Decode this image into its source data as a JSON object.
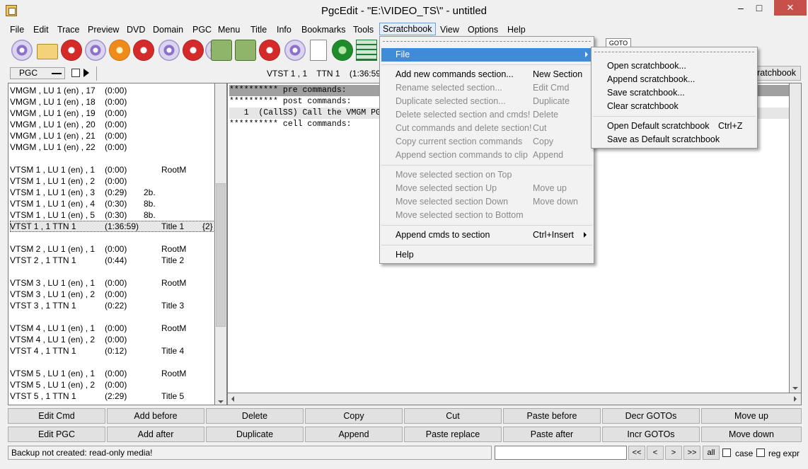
{
  "window": {
    "title": "PgcEdit -   \"E:\\VIDEO_TS\\\" - untitled",
    "min_glyph": "–",
    "max_glyph": "□",
    "close_glyph": "✕"
  },
  "menubar": [
    "File",
    "Edit",
    "Trace",
    "Preview",
    "DVD",
    "Domain",
    "PGC",
    "Menu",
    "Title",
    "Info",
    "Bookmarks",
    "Tools",
    "Scratchbook",
    "View",
    "Options",
    "Help"
  ],
  "toolbar": {
    "icons": [
      "open-disc-icon",
      "open-folder-icon",
      "reload-icon",
      "new-disc-icon",
      "burn-icon",
      "search-disc-icon",
      "compare-discs-icon",
      "remove-disc-icon",
      "preview-disc-icon",
      "money-icon",
      "money-check-icon",
      "check-disc-icon",
      "disc-tool-icon",
      "document-icon",
      "globe-icon",
      "play-grid-icon"
    ],
    "goto_label": "GOTO"
  },
  "pgc_bar": {
    "selector": "PGC",
    "info": "VTST 1 , 1    TTN 1    (1:36:59)    Ti",
    "scratchbook_button": "Scratchbook"
  },
  "pgc_list": [
    {
      "a": "VMGM , LU 1 (en) , 17",
      "b": "(0:00)",
      "c": "",
      "d": ""
    },
    {
      "a": "VMGM , LU 1 (en) , 18",
      "b": "(0:00)",
      "c": "",
      "d": ""
    },
    {
      "a": "VMGM , LU 1 (en) , 19",
      "b": "(0:00)",
      "c": "",
      "d": ""
    },
    {
      "a": "VMGM , LU 1 (en) , 20",
      "b": "(0:00)",
      "c": "",
      "d": ""
    },
    {
      "a": "VMGM , LU 1 (en) , 21",
      "b": "(0:00)",
      "c": "",
      "d": ""
    },
    {
      "a": "VMGM , LU 1 (en) , 22",
      "b": "(0:00)",
      "c": "",
      "d": ""
    },
    {
      "a": "",
      "b": "",
      "c": "",
      "d": ""
    },
    {
      "a": "VTSM 1 , LU 1 (en) , 1",
      "b": "(0:00)",
      "c": "",
      "d": "RootM"
    },
    {
      "a": "VTSM 1 , LU 1 (en) , 2",
      "b": "(0:00)",
      "c": "",
      "d": ""
    },
    {
      "a": "VTSM 1 , LU 1 (en) , 3",
      "b": "(0:29)",
      "c": "2b.",
      "d": ""
    },
    {
      "a": "VTSM 1 , LU 1 (en) , 4",
      "b": "(0:30)",
      "c": "8b.",
      "d": ""
    },
    {
      "a": "VTSM 1 , LU 1 (en) , 5",
      "b": "(0:30)",
      "c": "8b.",
      "d": ""
    },
    {
      "a": "VTST 1 , 1      TTN 1",
      "b": "(1:36:59)",
      "c": "",
      "d": "Title 1",
      "e": "{2}",
      "selected": true
    },
    {
      "a": "",
      "b": "",
      "c": "",
      "d": ""
    },
    {
      "a": "VTSM 2 , LU 1 (en) , 1",
      "b": "(0:00)",
      "c": "",
      "d": "RootM"
    },
    {
      "a": "VTST 2 , 1      TTN 1",
      "b": "(0:44)",
      "c": "",
      "d": "Title 2"
    },
    {
      "a": "",
      "b": "",
      "c": "",
      "d": ""
    },
    {
      "a": "VTSM 3 , LU 1 (en) , 1",
      "b": "(0:00)",
      "c": "",
      "d": "RootM"
    },
    {
      "a": "VTSM 3 , LU 1 (en) , 2",
      "b": "(0:00)",
      "c": "",
      "d": ""
    },
    {
      "a": "VTST 3 , 1      TTN 1",
      "b": "(0:22)",
      "c": "",
      "d": "Title 3"
    },
    {
      "a": "",
      "b": "",
      "c": "",
      "d": ""
    },
    {
      "a": "VTSM 4 , LU 1 (en) , 1",
      "b": "(0:00)",
      "c": "",
      "d": "RootM"
    },
    {
      "a": "VTSM 4 , LU 1 (en) , 2",
      "b": "(0:00)",
      "c": "",
      "d": ""
    },
    {
      "a": "VTST 4 , 1      TTN 1",
      "b": "(0:12)",
      "c": "",
      "d": "Title 4"
    },
    {
      "a": "",
      "b": "",
      "c": "",
      "d": ""
    },
    {
      "a": "VTSM 5 , LU 1 (en) , 1",
      "b": "(0:00)",
      "c": "",
      "d": "RootM"
    },
    {
      "a": "VTSM 5 , LU 1 (en) , 2",
      "b": "(0:00)",
      "c": "",
      "d": ""
    },
    {
      "a": "VTST 5 , 1      TTN 1",
      "b": "(2:29)",
      "c": "",
      "d": "Title 5"
    }
  ],
  "code_lines": [
    {
      "text": "********** pre commands:",
      "style": "hl"
    },
    {
      "text": "********** post commands:",
      "style": ""
    },
    {
      "text": "   1  (CallSS) Call the VMGM PGC",
      "style": "hl2"
    },
    {
      "text": "********** cell commands:",
      "style": ""
    }
  ],
  "action_buttons_row1": [
    "Edit Cmd",
    "Add before",
    "Delete",
    "Copy",
    "Cut",
    "Paste before",
    "Decr GOTOs",
    "Move up"
  ],
  "action_buttons_row2": [
    "Edit PGC",
    "Add after",
    "Duplicate",
    "Append",
    "Paste replace",
    "Paste after",
    "Incr GOTOs",
    "Move down"
  ],
  "statusbar": {
    "message": "Backup not created: read-only media!",
    "search_value": "",
    "nav": [
      "<<",
      "<",
      ">",
      ">>",
      "all"
    ],
    "case_label": "case",
    "regexpr_label": "reg expr"
  },
  "scratchbook_menu": [
    {
      "label": "File",
      "acc": "",
      "state": "hot",
      "submenu": true
    },
    {
      "sep": true
    },
    {
      "label": "Add new commands section...",
      "acc": "New Section",
      "state": ""
    },
    {
      "label": "Rename selected section...",
      "acc": "Edit Cmd",
      "state": "dis"
    },
    {
      "label": "Duplicate selected section...",
      "acc": "Duplicate",
      "state": "dis"
    },
    {
      "label": "Delete selected section and cmds!",
      "acc": "Delete",
      "state": "dis"
    },
    {
      "label": "Cut commands and delete section!",
      "acc": "Cut",
      "state": "dis"
    },
    {
      "label": "Copy current section commands",
      "acc": "Copy",
      "state": "dis"
    },
    {
      "label": "Append section commands to clip",
      "acc": "Append",
      "state": "dis"
    },
    {
      "sep": true
    },
    {
      "label": "Move selected section on Top",
      "acc": "",
      "state": "dis"
    },
    {
      "label": "Move selected section Up",
      "acc": "Move up",
      "state": "dis"
    },
    {
      "label": "Move selected section Down",
      "acc": "Move down",
      "state": "dis"
    },
    {
      "label": "Move selected section to Bottom",
      "acc": "",
      "state": "dis"
    },
    {
      "sep": true
    },
    {
      "label": "Append cmds to section",
      "acc": "Ctrl+Insert",
      "state": "",
      "submenu": true
    },
    {
      "sep": true
    },
    {
      "label": "Help",
      "acc": "",
      "state": ""
    }
  ],
  "file_submenu": [
    {
      "label": "Open scratchbook...",
      "acc": ""
    },
    {
      "label": "Append scratchbook...",
      "acc": ""
    },
    {
      "label": "Save scratchbook...",
      "acc": ""
    },
    {
      "label": "Clear scratchbook",
      "acc": ""
    },
    {
      "sep": true
    },
    {
      "label": "Open Default scratchbook",
      "acc": "Ctrl+Z"
    },
    {
      "label": "Save as Default scratchbook",
      "acc": ""
    }
  ]
}
